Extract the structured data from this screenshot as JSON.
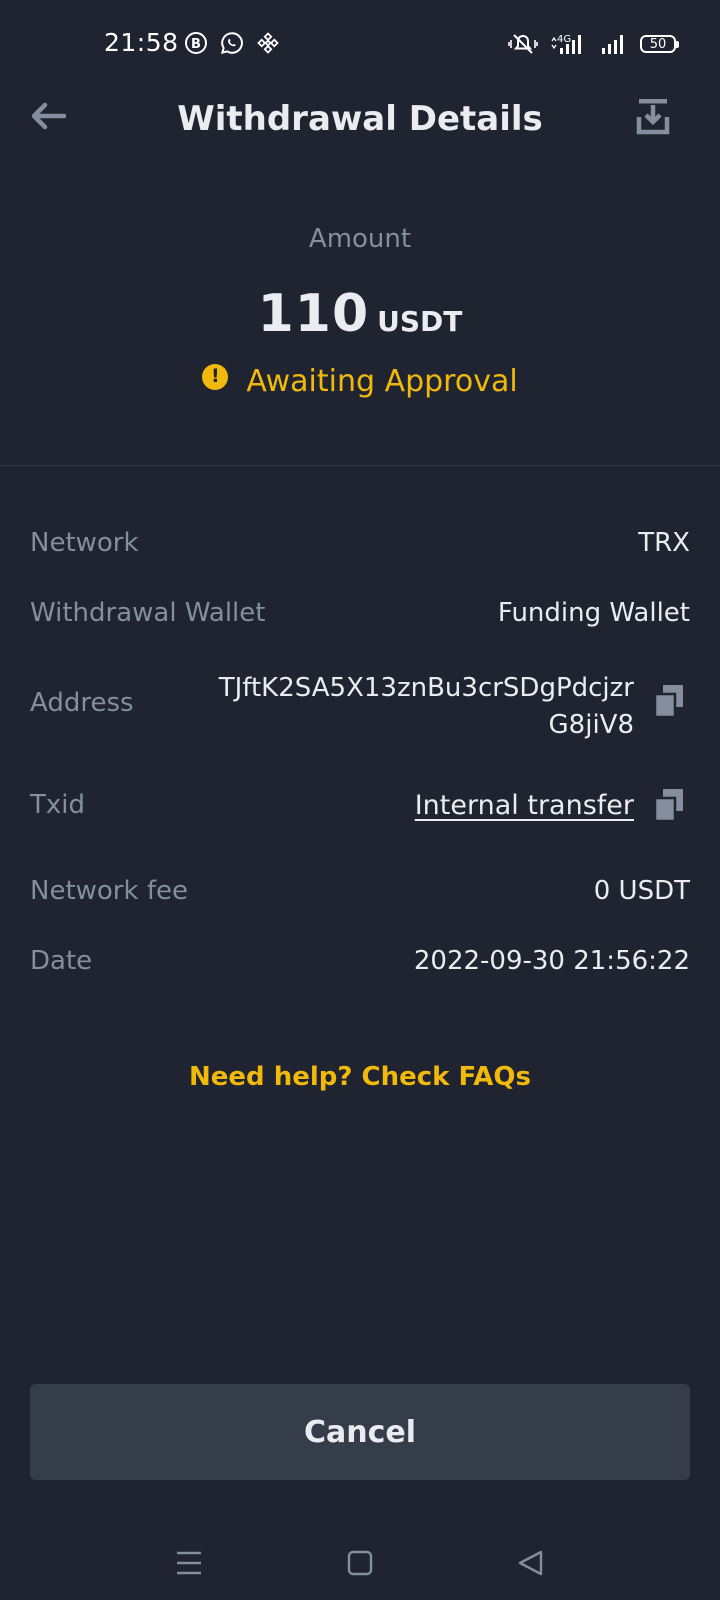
{
  "status_bar": {
    "time": "21:58",
    "battery": "50",
    "network_type": "4G",
    "left_icons": [
      "b-badge-icon",
      "whatsapp-icon",
      "binance-icon"
    ],
    "right_icons": [
      "mute-vibrate-icon",
      "signal-4g-icon",
      "signal-icon",
      "battery-icon"
    ]
  },
  "header": {
    "title": "Withdrawal Details",
    "back_icon": "arrow-left-icon",
    "action_icon": "download-icon"
  },
  "amount": {
    "label": "Amount",
    "value": "110",
    "unit": "USDT",
    "status": "Awaiting Approval",
    "status_icon": "exclamation-circle-icon",
    "status_color": "#f0b90b"
  },
  "details": {
    "network": {
      "label": "Network",
      "value": "TRX"
    },
    "wallet": {
      "label": "Withdrawal Wallet",
      "value": "Funding Wallet"
    },
    "address": {
      "label": "Address",
      "value": "TJftK2SA5X13znBu3crSDgPdcjzrG8jiV8"
    },
    "txid": {
      "label": "Txid",
      "value": "Internal transfer"
    },
    "fee": {
      "label": "Network fee",
      "value": "0 USDT"
    },
    "date": {
      "label": "Date",
      "value": "2022-09-30 21:56:22"
    }
  },
  "faq_link": "Need help? Check FAQs",
  "cancel_button": "Cancel",
  "colors": {
    "background": "#1f2430",
    "accent": "#f0b90b",
    "muted_text": "#848e9c",
    "button_bg": "#363d4a"
  },
  "nav_bar": {
    "icons": [
      "menu-icon",
      "home-square-icon",
      "back-triangle-icon"
    ]
  }
}
